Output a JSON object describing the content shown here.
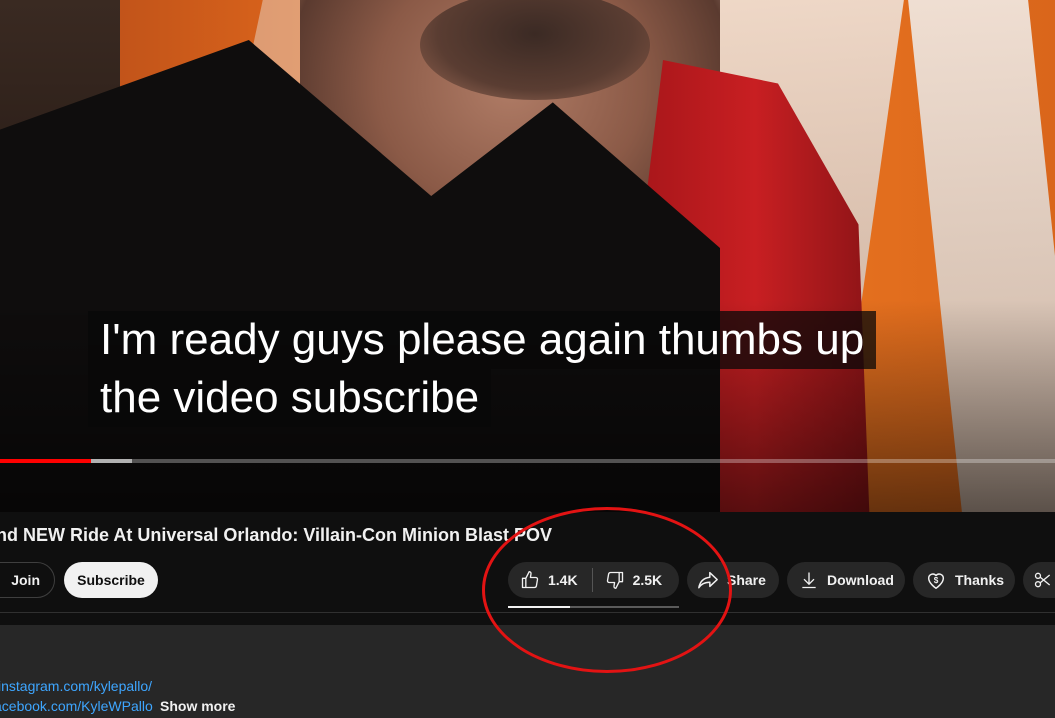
{
  "video": {
    "caption_lines": [
      "I'm ready guys please again thumbs up",
      "the video subscribe"
    ],
    "progress": {
      "played_fraction": 0.086,
      "buffered_fraction": 0.125,
      "played_color": "#ff0000"
    }
  },
  "title": "nd NEW Ride At Universal Orlando: Villain-Con Minion Blast POV",
  "actions": {
    "join_label": "Join",
    "subscribe_label": "Subscribe",
    "like_count": "1.4K",
    "dislike_count": "2.5K",
    "like_ratio_fraction": 0.36,
    "share_label": "Share",
    "download_label": "Download",
    "thanks_label": "Thanks",
    "icons": [
      "thumbs-up-icon",
      "thumbs-down-icon",
      "share-icon",
      "download-icon",
      "thanks-icon",
      "scissors-icon"
    ]
  },
  "description": {
    "link1": "instagram.com/kylepallo/",
    "link2": "acebook.com/KyleWPallo",
    "show_more": "Show more"
  },
  "annotation": {
    "color": "#e31313"
  }
}
